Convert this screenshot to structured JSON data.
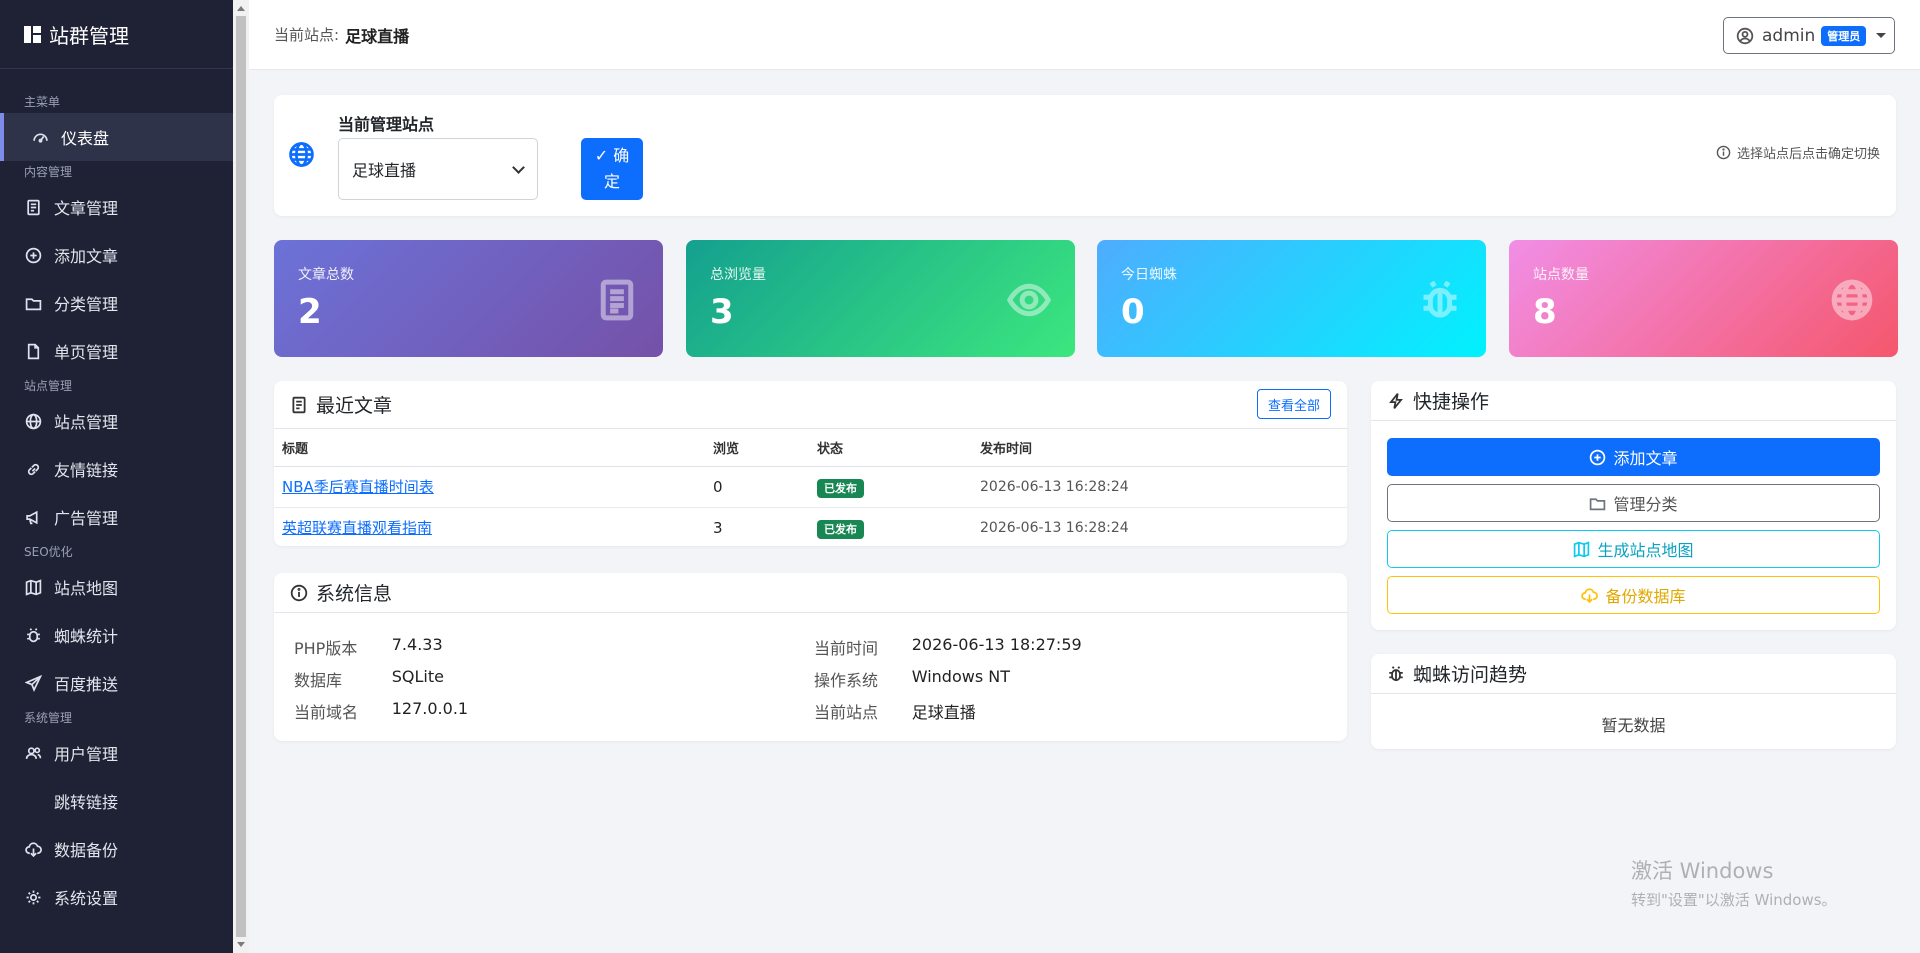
{
  "sidebar": {
    "brand": "站群管理",
    "sections": {
      "main": "主菜单",
      "content": "内容管理",
      "site": "站点管理",
      "seo": "SEO优化",
      "system": "系统管理"
    },
    "items": {
      "dashboard": "仪表盘",
      "articles": "文章管理",
      "add_article": "添加文章",
      "categories": "分类管理",
      "pages": "单页管理",
      "sites": "站点管理",
      "links": "友情链接",
      "ads": "广告管理",
      "sitemap": "站点地图",
      "spider": "蜘蛛统计",
      "baidu": "百度推送",
      "users": "用户管理",
      "redirect": "跳转链接",
      "backup": "数据备份",
      "settings": "系统设置"
    }
  },
  "topbar": {
    "label": "当前站点:",
    "site": "足球直播",
    "user": "admin",
    "role": "管理员"
  },
  "site_selector": {
    "title": "当前管理站点",
    "selected": "足球直播",
    "confirm_1": "确",
    "confirm_2": "定",
    "hint": "选择站点后点击确定切换"
  },
  "stats": [
    {
      "label": "文章总数",
      "value": "2"
    },
    {
      "label": "总浏览量",
      "value": "3"
    },
    {
      "label": "今日蜘蛛",
      "value": "0"
    },
    {
      "label": "站点数量",
      "value": "8"
    }
  ],
  "recent": {
    "title": "最近文章",
    "view_all": "查看全部",
    "columns": [
      "标题",
      "浏览",
      "状态",
      "发布时间"
    ],
    "rows": [
      {
        "title": "NBA季后赛直播时间表",
        "views": "0",
        "status": "已发布",
        "time": "2026-06-13 16:28:24"
      },
      {
        "title": "英超联赛直播观看指南",
        "views": "3",
        "status": "已发布",
        "time": "2026-06-13 16:28:24"
      }
    ]
  },
  "sysinfo": {
    "title": "系统信息",
    "php_k": "PHP版本",
    "php_v": "7.4.33",
    "time_k": "当前时间",
    "time_v": "2026-06-13 18:27:59",
    "db_k": "数据库",
    "db_v": "SQLite",
    "os_k": "操作系统",
    "os_v": "Windows NT",
    "domain_k": "当前域名",
    "domain_v": "127.0.0.1",
    "site_k": "当前站点",
    "site_v": "足球直播"
  },
  "quick": {
    "title": "快捷操作",
    "add": "添加文章",
    "cats": "管理分类",
    "sitemap": "生成站点地图",
    "backup": "备份数据库"
  },
  "spider": {
    "title": "蜘蛛访问趋势",
    "empty": "暂无数据"
  },
  "watermark": {
    "line1": "激活 Windows",
    "line2": "转到\"设置\"以激活 Windows。"
  }
}
